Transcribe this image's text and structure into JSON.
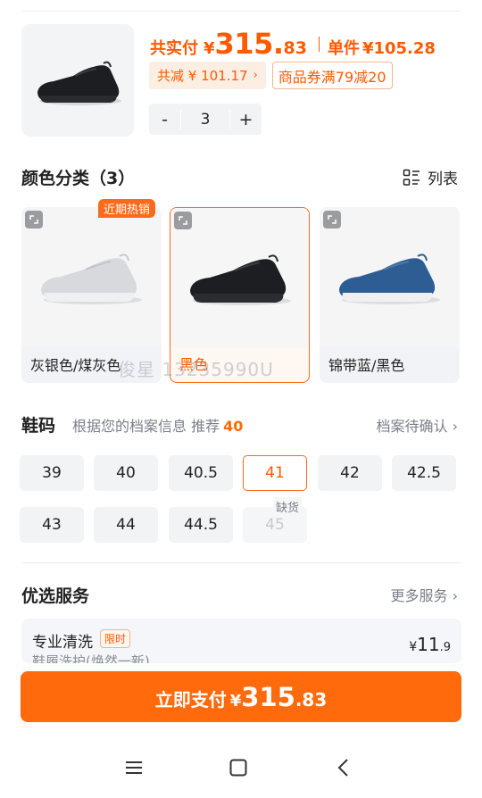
{
  "product": {
    "price_label": "共实付",
    "currency": "¥",
    "price_int": "315.",
    "price_dec": "83",
    "unit_label": "单件",
    "unit_price": "¥105.28",
    "discount_tag": "共减 ¥ 101.17",
    "coupon_tag": "商品券满79减20",
    "quantity": {
      "minus": "-",
      "value": "3",
      "plus": "+"
    }
  },
  "colors": {
    "title": "颜色分类（3）",
    "list_toggle": "列表",
    "hot_badge": "近期热销",
    "items": [
      {
        "label": "灰银色/煤灰色",
        "selected": false
      },
      {
        "label": "黑色",
        "selected": true
      },
      {
        "label": "锦带蓝/黑色",
        "selected": false
      }
    ]
  },
  "watermark": "俊星 13235990U",
  "sizes": {
    "title": "鞋码",
    "hint": "根据您的档案信息 推荐",
    "recommended": "40",
    "profile_link": "档案待确认",
    "out_of_stock_label": "缺货",
    "items": [
      "39",
      "40",
      "40.5",
      "41",
      "42",
      "42.5",
      "43",
      "44",
      "44.5",
      "45"
    ],
    "selected": "41",
    "disabled": [
      "45"
    ]
  },
  "services": {
    "title": "优选服务",
    "more_link": "更多服务",
    "item": {
      "name": "专业清洗",
      "badge": "限时",
      "subtitle": "鞋履洗护(焕然一新)",
      "currency": "¥",
      "price_int": "11",
      "price_dec": ".9"
    }
  },
  "pay_button": {
    "label": "立即支付",
    "currency": "¥",
    "price_int": "315",
    "price_dec": ".83"
  },
  "colors_palette": {
    "accent": "#ff6a0c",
    "price": "#ff5a00",
    "muted": "#7a7f88"
  }
}
